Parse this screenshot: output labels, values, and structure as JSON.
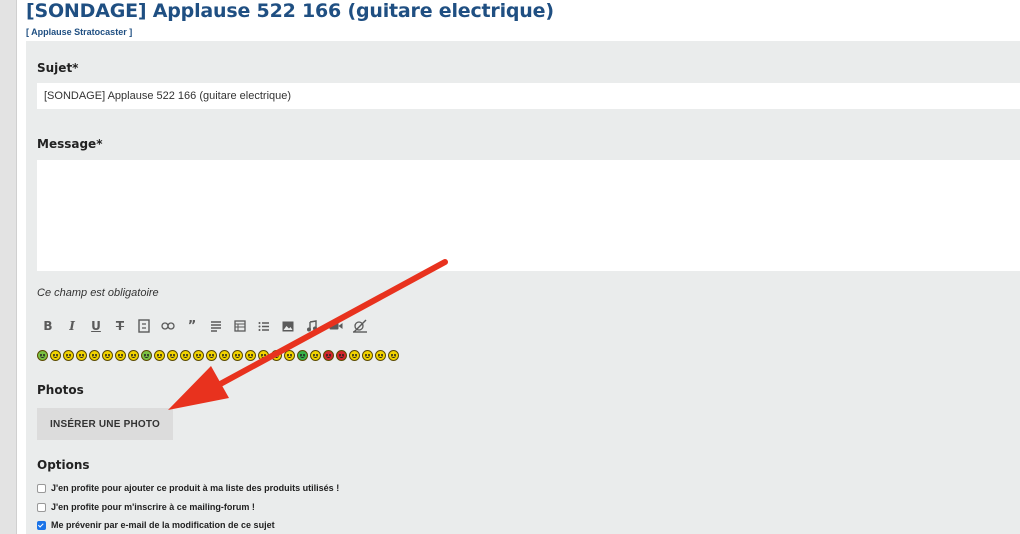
{
  "page": {
    "title": "[SONDAGE] Applause 522 166 (guitare electrique)",
    "breadcrumb": "[ Applause Stratocaster ]"
  },
  "form": {
    "subject_label": "Sujet*",
    "subject_value": "[SONDAGE] Applause 522 166 (guitare electrique)",
    "message_label": "Message*",
    "message_value": "",
    "required_hint": "Ce champ est obligatoire",
    "photos_label": "Photos",
    "insert_photo_label": "INSÉRER UNE PHOTO",
    "options_label": "Options",
    "options": [
      {
        "label": "J'en profite pour ajouter ce produit à ma liste des produits utilisés !",
        "checked": false
      },
      {
        "label": "J'en profite pour m'inscrire à ce mailing-forum !",
        "checked": false
      },
      {
        "label": "Me prévenir par e-mail de la modification de ce sujet",
        "checked": true
      }
    ]
  },
  "toolbar": {
    "buttons": [
      "bold-icon",
      "italic-icon",
      "underline-icon",
      "strikethrough-icon",
      "spoiler-icon",
      "link-icon",
      "quote-icon",
      "align-icon",
      "table-icon",
      "list-icon",
      "image-icon",
      "music-icon",
      "video-icon",
      "no-smiley-icon"
    ]
  },
  "emojis": {
    "colors": [
      "#7ac143",
      "#f2d300",
      "#f2d300",
      "#f2d300",
      "#f2d300",
      "#f2d300",
      "#f2d300",
      "#f2d300",
      "#7ac143",
      "#f2d300",
      "#f2d300",
      "#f2d300",
      "#f2d300",
      "#f2d300",
      "#f2d300",
      "#f2d300",
      "#f2d300",
      "#f2d300",
      "#f2d300",
      "#f2d300",
      "#37b34a",
      "#f2d300",
      "#d4262c",
      "#d4262c",
      "#f2d300",
      "#f2d300",
      "#f2d300",
      "#f2d300"
    ]
  },
  "colors": {
    "title": "#1f4f82",
    "panel": "#eaecec",
    "arrow": "#e8321e"
  }
}
